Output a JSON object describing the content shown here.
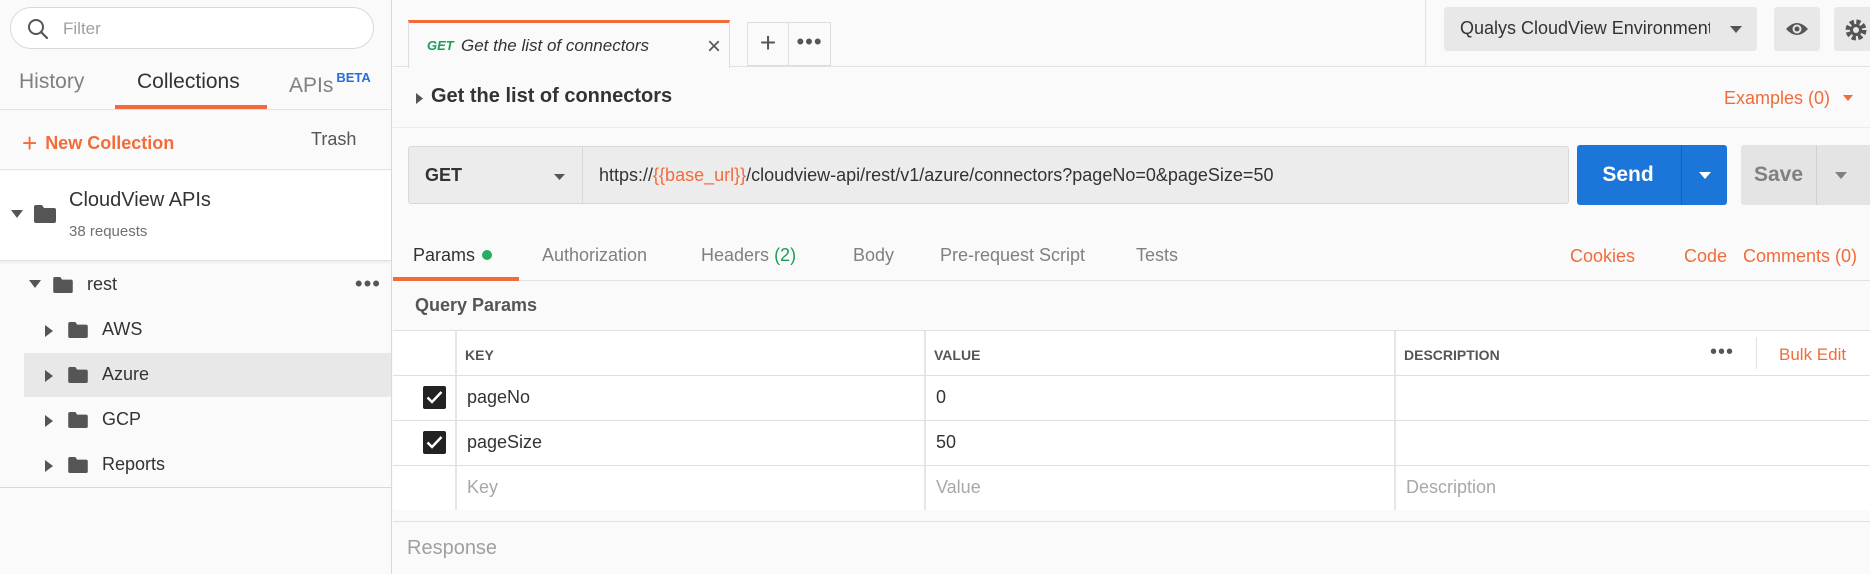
{
  "sidebar": {
    "filter_placeholder": "Filter",
    "tabs": {
      "history": "History",
      "collections": "Collections",
      "apis": "APIs",
      "apis_badge": "BETA"
    },
    "new_collection": "New Collection",
    "trash": "Trash",
    "collection": {
      "name": "CloudView APIs",
      "count": "38 requests"
    },
    "tree": [
      {
        "label": "rest"
      },
      {
        "label": "AWS"
      },
      {
        "label": "Azure"
      },
      {
        "label": "GCP"
      },
      {
        "label": "Reports"
      }
    ]
  },
  "tabbar": {
    "tab_method": "GET",
    "tab_title": "Get the list of connectors",
    "environment": "Qualys CloudView Environment"
  },
  "request": {
    "name": "Get the list of connectors",
    "examples": "Examples (0)",
    "method": "GET",
    "url_prefix": "https://",
    "url_var": "{{base_url}}",
    "url_suffix": "/cloudview-api/rest/v1/azure/connectors?pageNo=0&pageSize=50",
    "send": "Send",
    "save": "Save"
  },
  "request_tabs": {
    "params": "Params",
    "authorization": "Authorization",
    "headers": "Headers",
    "headers_count": "(2)",
    "body": "Body",
    "pre_request": "Pre-request Script",
    "tests": "Tests",
    "cookies": "Cookies",
    "code": "Code",
    "comments": "Comments (0)"
  },
  "params": {
    "title": "Query Params",
    "headers": {
      "key": "KEY",
      "value": "VALUE",
      "description": "DESCRIPTION"
    },
    "bulk_edit": "Bulk Edit",
    "rows": [
      {
        "checked": true,
        "key": "pageNo",
        "value": "0",
        "description": ""
      },
      {
        "checked": true,
        "key": "pageSize",
        "value": "50",
        "description": ""
      }
    ],
    "placeholders": {
      "key": "Key",
      "value": "Value",
      "description": "Description"
    }
  },
  "response": {
    "label": "Response"
  },
  "colors": {
    "accent": "#f26b3a",
    "send": "#1c75d8",
    "success": "#1b9e5a"
  }
}
